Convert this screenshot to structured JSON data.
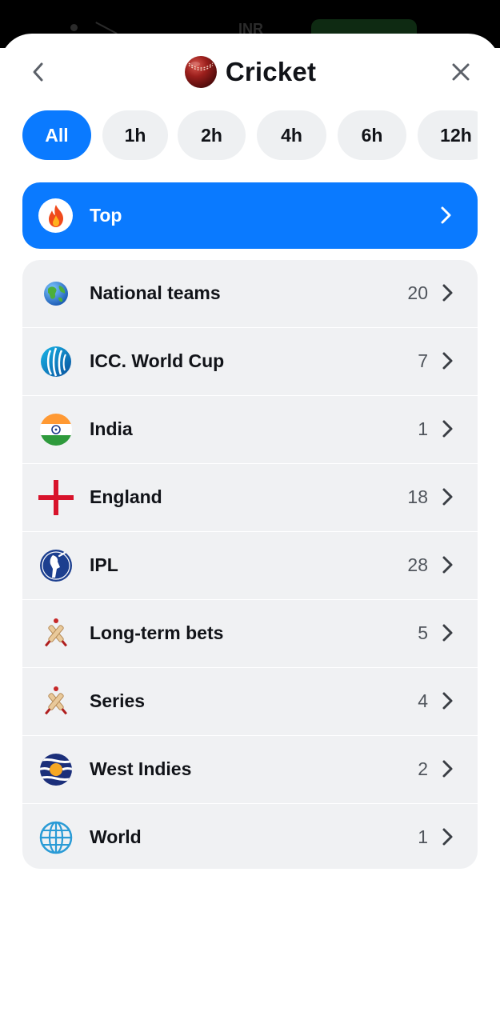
{
  "status_bar": {
    "currency": "INR"
  },
  "header": {
    "title": "Cricket",
    "icons": {
      "back": "chevron-left-icon",
      "close": "close-icon",
      "sport": "cricket-ball-icon"
    }
  },
  "filters": [
    {
      "label": "All",
      "active": true
    },
    {
      "label": "1h",
      "active": false
    },
    {
      "label": "2h",
      "active": false
    },
    {
      "label": "4h",
      "active": false
    },
    {
      "label": "6h",
      "active": false
    },
    {
      "label": "12h",
      "active": false
    }
  ],
  "top": {
    "label": "Top",
    "icon": "fire-icon"
  },
  "categories": [
    {
      "name": "National teams",
      "count": "20",
      "icon": "globe-icon"
    },
    {
      "name": "ICC. World Cup",
      "count": "7",
      "icon": "icc-world-cup-icon"
    },
    {
      "name": "India",
      "count": "1",
      "icon": "india-flag-icon"
    },
    {
      "name": "England",
      "count": "18",
      "icon": "england-flag-icon"
    },
    {
      "name": "IPL",
      "count": "28",
      "icon": "ipl-logo-icon"
    },
    {
      "name": "Long-term bets",
      "count": "5",
      "icon": "crossed-bats-icon"
    },
    {
      "name": "Series",
      "count": "4",
      "icon": "crossed-bats-icon"
    },
    {
      "name": "West Indies",
      "count": "2",
      "icon": "west-indies-flag-icon"
    },
    {
      "name": "World",
      "count": "1",
      "icon": "world-globe-icon"
    }
  ],
  "colors": {
    "accent": "#0a7aff",
    "chip_bg": "#eef0f2",
    "list_bg": "#f0f1f3",
    "text": "#111318",
    "muted": "#50555c"
  }
}
